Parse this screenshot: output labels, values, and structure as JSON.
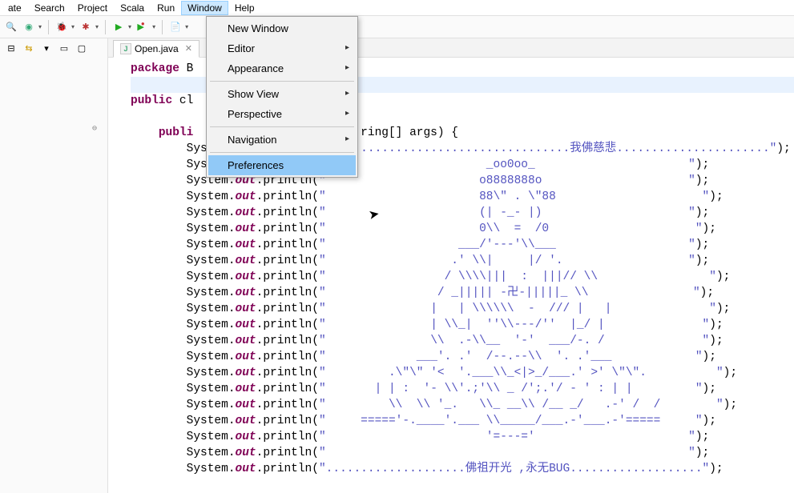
{
  "menubar": [
    "ate",
    "Search",
    "Project",
    "Scala",
    "Run",
    "Window",
    "Help"
  ],
  "active_menu_index": 5,
  "dropdown": {
    "groups": [
      [
        {
          "label": "New Window",
          "submenu": false
        },
        {
          "label": "Editor",
          "submenu": true
        },
        {
          "label": "Appearance",
          "submenu": true
        }
      ],
      [
        {
          "label": "Show View",
          "submenu": true
        },
        {
          "label": "Perspective",
          "submenu": true
        }
      ],
      [
        {
          "label": "Navigation",
          "submenu": true
        }
      ],
      [
        {
          "label": "Preferences",
          "submenu": false,
          "highlight": true
        }
      ]
    ]
  },
  "tab": {
    "filename": "Open.java"
  },
  "code": {
    "line1_kw": "package",
    "line1_rest": " B",
    "line3_kw": "public",
    "line3_rest": " cl",
    "line5_indent": "    ",
    "line5_kw": "publi",
    "line5_tail": "ring[] args) {",
    "print_prefix_a": "        System.",
    "print_out": "out",
    "print_prefix_b": ".println(",
    "print_suffix": ");",
    "strings": [
      "\"...................................我佛慈悲......................\"",
      "\"                       _oo0oo_                      \"",
      "\"                      o8888888o                     \"",
      "\"                      88\\\" . \\\"88                     \"",
      "\"                      (| -_- |)                     \"",
      "\"                      0\\\\  =  /0                     \"",
      "\"                   ___/'---'\\\\___                   \"",
      "\"                  .' \\\\|     |/ '.                  \"",
      "\"                 / \\\\\\\\|||  :  |||// \\\\                \"",
      "\"                / _||||| -卍-|||||_ \\\\               \"",
      "\"               |   | \\\\\\\\\\\\  -  /// |   |              \"",
      "\"               | \\\\_|  ''\\\\---/''  |_/ |              \"",
      "\"               \\\\  .-\\\\__  '-'  ___/-. /              \"",
      "\"             ___'. .'  /--.--\\\\  '. .'___            \"",
      "\"         .\\\"\\\" '<  '.___\\\\_<|>_/___.' >' \\\"\\\".          \"",
      "\"       | | :  '- \\\\'.;'\\\\ _ /';.'/ - ' : | |         \"",
      "\"         \\\\  \\\\ '_.   \\\\_ __\\\\ /__ _/   .-' /  /        \"",
      "\"     ====='-.____'.___ \\\\_____/___.-'___.-'=====     \"",
      "\"                       '=---='                      \"",
      "\"                                                    \"",
      "\"....................佛祖开光 ,永无BUG...................\""
    ]
  }
}
